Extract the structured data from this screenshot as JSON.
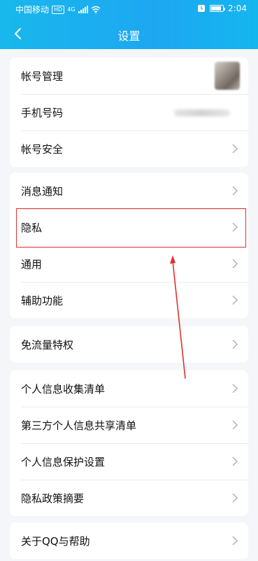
{
  "status_bar": {
    "carrier": "中国移动",
    "network_badge": "HD",
    "signal_type": "4G",
    "time": "2:04",
    "icons": [
      "signal-icon",
      "wifi-icon",
      "alarm-icon",
      "battery-icon"
    ]
  },
  "header": {
    "title": "设置",
    "back_icon": "chevron-left-icon"
  },
  "groups": [
    {
      "items": [
        {
          "label": "帐号管理",
          "trailing": "avatar"
        },
        {
          "label": "手机号码",
          "trailing": "blurred-phone"
        },
        {
          "label": "帐号安全",
          "trailing": "chevron"
        }
      ]
    },
    {
      "items": [
        {
          "label": "消息通知",
          "trailing": "chevron"
        },
        {
          "label": "隐私",
          "trailing": "chevron",
          "highlighted": true
        },
        {
          "label": "通用",
          "trailing": "chevron"
        },
        {
          "label": "辅助功能",
          "trailing": "chevron"
        }
      ]
    },
    {
      "items": [
        {
          "label": "免流量特权",
          "trailing": "chevron"
        }
      ]
    },
    {
      "items": [
        {
          "label": "个人信息收集清单",
          "trailing": "chevron"
        },
        {
          "label": "第三方个人信息共享清单",
          "trailing": "chevron"
        },
        {
          "label": "个人信息保护设置",
          "trailing": "chevron"
        },
        {
          "label": "隐私政策摘要",
          "trailing": "chevron"
        }
      ]
    },
    {
      "items": [
        {
          "label": "关于QQ与帮助",
          "trailing": "chevron"
        }
      ]
    }
  ],
  "colors": {
    "header_start": "#18b8ec",
    "header_end": "#1da7f2",
    "annotation_red": "#e0322c",
    "page_bg": "#f5f6fa"
  }
}
